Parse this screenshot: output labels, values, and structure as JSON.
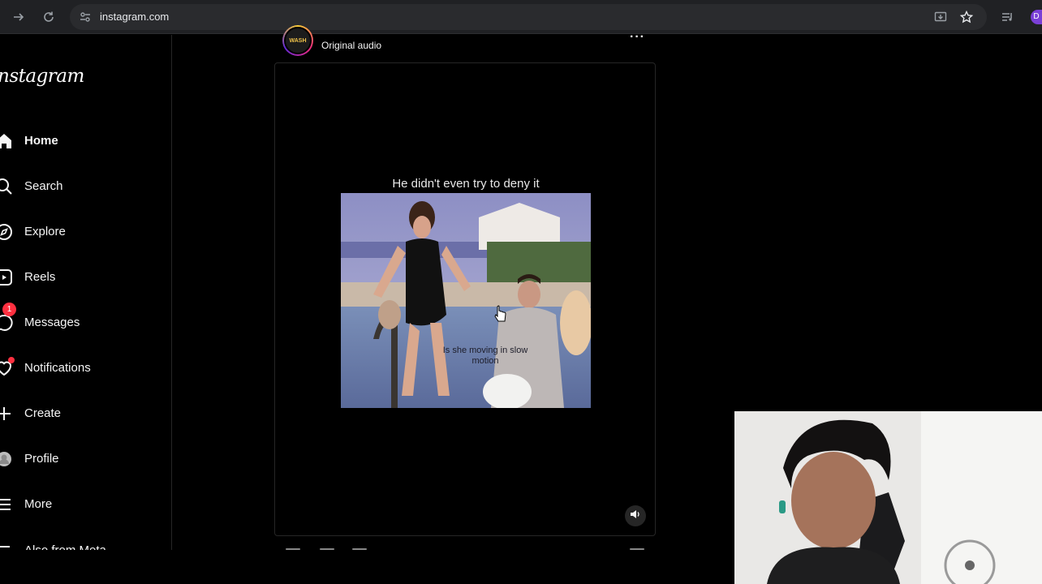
{
  "browser": {
    "url": "instagram.com",
    "profile_initial": "D",
    "icons": [
      "forward-icon",
      "reload-icon",
      "site-info-icon",
      "install-app-icon",
      "star-icon",
      "reading-list-icon"
    ]
  },
  "sidebar": {
    "logo": "nstagram",
    "items": [
      {
        "label": "Home",
        "icon": "home-icon",
        "active": true
      },
      {
        "label": "Search",
        "icon": "search-icon"
      },
      {
        "label": "Explore",
        "icon": "compass-icon"
      },
      {
        "label": "Reels",
        "icon": "reels-icon"
      },
      {
        "label": "Messages",
        "icon": "messenger-icon",
        "badge": "1"
      },
      {
        "label": "Notifications",
        "icon": "heart-icon"
      },
      {
        "label": "Create",
        "icon": "plus-icon"
      },
      {
        "label": "Profile",
        "icon": "avatar"
      },
      {
        "label": "More",
        "icon": "menu-icon"
      }
    ],
    "also_from_meta": "Also from Meta"
  },
  "post": {
    "audio": "Original audio",
    "avatar_text": "WASH",
    "caption": "He didn't even try to deny it",
    "subtitle": "Is she moving in slow motion",
    "more": "···"
  },
  "colors": {
    "background": "#000000",
    "chrome": "#202124",
    "badge": "#ff3040",
    "border": "#262626"
  }
}
